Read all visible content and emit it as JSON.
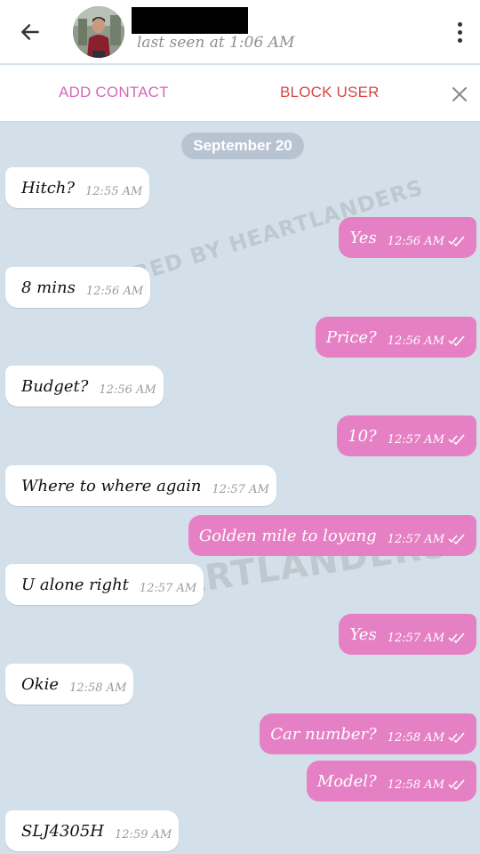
{
  "header": {
    "back_icon": "arrow-left-icon",
    "contact_name": "",
    "last_seen": "last seen at 1:06 AM",
    "menu_icon": "more-vertical-icon"
  },
  "action_bar": {
    "add_contact": "ADD CONTACT",
    "block_user": "BLOCK USER",
    "close_icon": "close-icon"
  },
  "chat": {
    "date": "September 20",
    "watermarks": [
      "SHARED BY HEARTLANDERS",
      "HEARTLANDERS"
    ],
    "messages": [
      {
        "dir": "in",
        "text": "Hitch?",
        "time": "12:55 AM"
      },
      {
        "dir": "out",
        "text": "Yes",
        "time": "12:56 AM",
        "read": true
      },
      {
        "dir": "in",
        "text": "8 mins",
        "time": "12:56 AM"
      },
      {
        "dir": "out",
        "text": "Price?",
        "time": "12:56 AM",
        "read": true
      },
      {
        "dir": "in",
        "text": "Budget?",
        "time": "12:56 AM"
      },
      {
        "dir": "out",
        "text": "10?",
        "time": "12:57 AM",
        "read": true
      },
      {
        "dir": "in",
        "text": "Where to where again",
        "time": "12:57 AM"
      },
      {
        "dir": "out",
        "text": "Golden mile to loyang",
        "time": "12:57 AM",
        "read": true
      },
      {
        "dir": "in",
        "text": "U alone right",
        "time": "12:57 AM"
      },
      {
        "dir": "out",
        "text": "Yes",
        "time": "12:57 AM",
        "read": true
      },
      {
        "dir": "in",
        "text": "Okie",
        "time": "12:58 AM"
      },
      {
        "dir": "out",
        "text": "Car number?",
        "time": "12:58 AM",
        "read": true
      },
      {
        "dir": "out",
        "text": "Model?",
        "time": "12:58 AM",
        "read": true
      },
      {
        "dir": "in",
        "text": "SLJ4305H",
        "time": "12:59 AM"
      }
    ]
  },
  "colors": {
    "chat_background": "#d3e0ea",
    "outgoing_bubble": "#e680c4",
    "incoming_bubble": "#ffffff",
    "add_contact": "#d667b7",
    "block_user": "#d84545",
    "date_chip": "#b7c3d1"
  }
}
